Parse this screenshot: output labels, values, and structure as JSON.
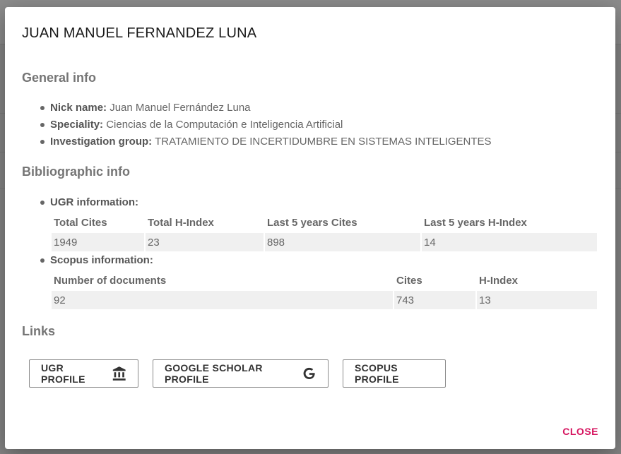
{
  "dialog": {
    "title": "JUAN MANUEL FERNANDEZ LUNA",
    "general": {
      "heading": "General info",
      "nick_label": "Nick name:",
      "nick_value": "Juan Manuel Fernández Luna",
      "speciality_label": "Speciality:",
      "speciality_value": "Ciencias de la Computación e Inteligencia Artificial",
      "group_label": "Investigation group:",
      "group_value": "TRATAMIENTO DE INCERTIDUMBRE EN SISTEMAS INTELIGENTES"
    },
    "biblio": {
      "heading": "Bibliographic info",
      "ugr_label": "UGR information:",
      "ugr_headers": [
        "Total Cites",
        "Total H-Index",
        "Last 5 years Cites",
        "Last 5 years H-Index"
      ],
      "ugr_values": [
        "1949",
        "23",
        "898",
        "14"
      ],
      "scopus_label": "Scopus information:",
      "scopus_headers": [
        "Number of documents",
        "Cites",
        "H-Index"
      ],
      "scopus_values": [
        "92",
        "743",
        "13"
      ]
    },
    "links": {
      "heading": "Links",
      "ugr_button": "UGR PROFILE",
      "scholar_button": "GOOGLE SCHOLAR PROFILE",
      "scopus_button": "SCOPUS PROFILE"
    },
    "close_label": "CLOSE"
  },
  "icons": {
    "ugr": "institution-icon",
    "scholar": "google-icon"
  },
  "colors": {
    "accent": "#d6145f",
    "heading": "#757575",
    "cell_bg": "#f0f0f0"
  }
}
